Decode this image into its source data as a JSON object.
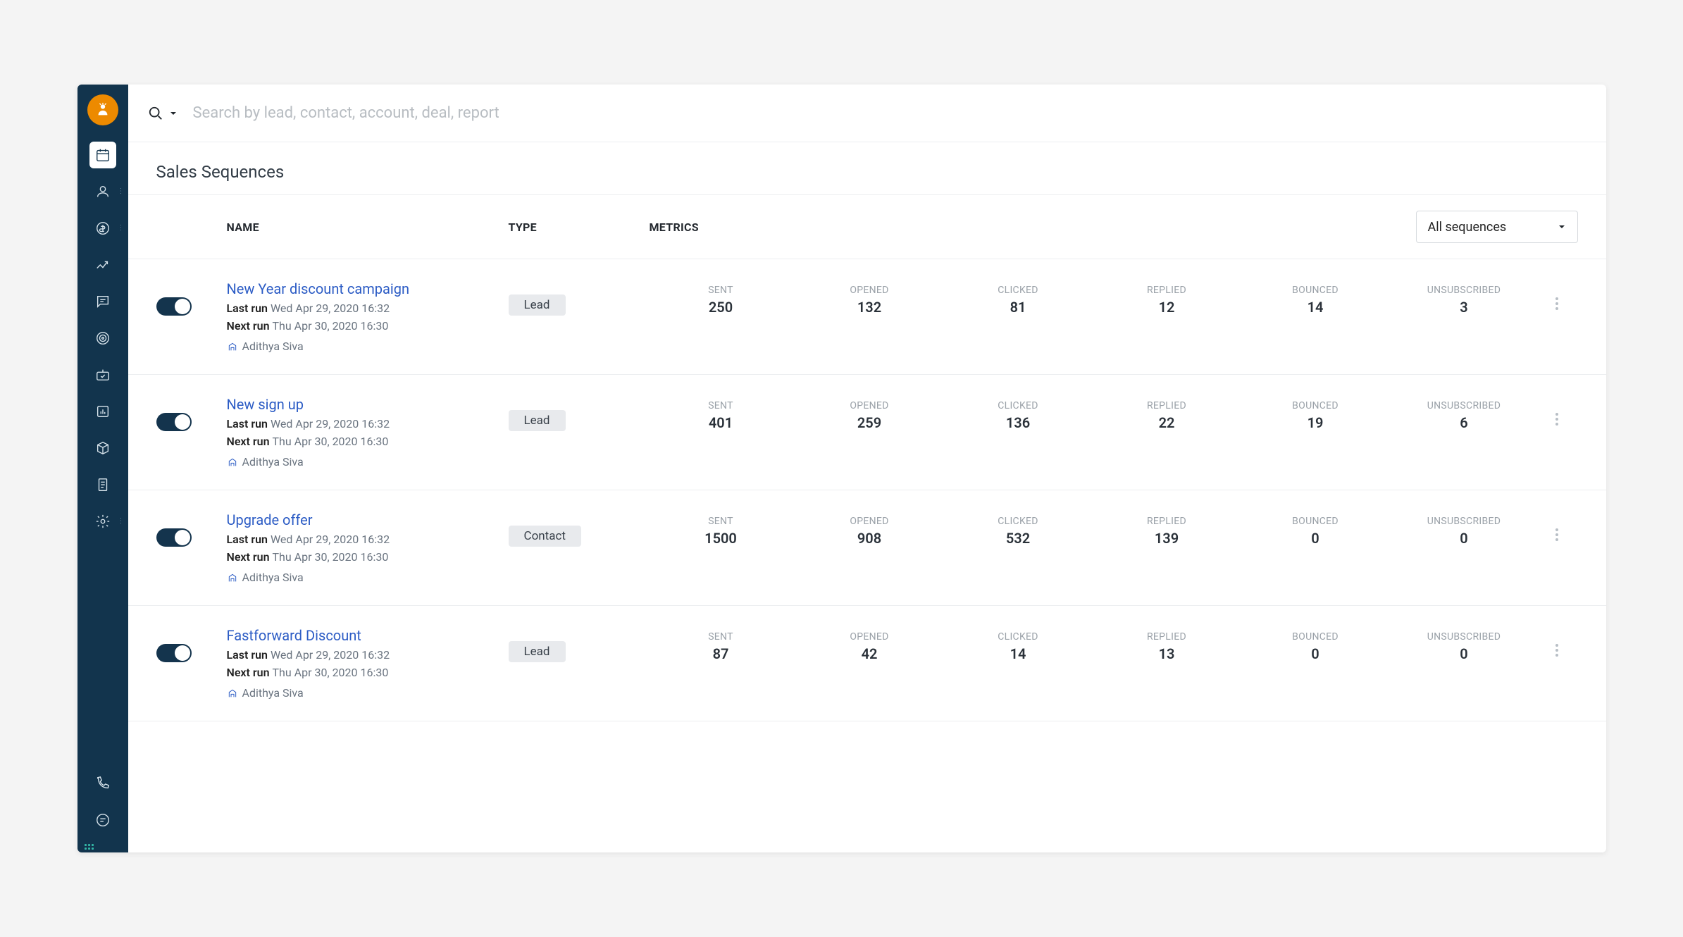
{
  "search": {
    "placeholder": "Search by lead, contact, account, deal, report"
  },
  "page": {
    "title": "Sales Sequences"
  },
  "table": {
    "headers": {
      "name": "NAME",
      "type": "TYPE",
      "metrics": "METRICS"
    },
    "filter_label": "All sequences",
    "metric_labels": [
      "SENT",
      "OPENED",
      "CLICKED",
      "REPLIED",
      "BOUNCED",
      "UNSUBSCRIBED"
    ],
    "run_labels": {
      "last": "Last run",
      "next": "Next run"
    }
  },
  "rows": [
    {
      "name": "New Year discount campaign",
      "last_run": "Wed Apr 29, 2020 16:32",
      "next_run": "Thu Apr 30, 2020 16:30",
      "owner": "Adithya Siva",
      "type": "Lead",
      "metrics": {
        "sent": "250",
        "opened": "132",
        "clicked": "81",
        "replied": "12",
        "bounced": "14",
        "unsubscribed": "3"
      }
    },
    {
      "name": "New sign up",
      "last_run": "Wed Apr 29, 2020 16:32",
      "next_run": "Thu Apr 30, 2020 16:30",
      "owner": "Adithya Siva",
      "type": "Lead",
      "metrics": {
        "sent": "401",
        "opened": "259",
        "clicked": "136",
        "replied": "22",
        "bounced": "19",
        "unsubscribed": "6"
      }
    },
    {
      "name": "Upgrade offer",
      "last_run": "Wed Apr 29, 2020 16:32",
      "next_run": "Thu Apr 30, 2020 16:30",
      "owner": "Adithya Siva",
      "type": "Contact",
      "metrics": {
        "sent": "1500",
        "opened": "908",
        "clicked": "532",
        "replied": "139",
        "bounced": "0",
        "unsubscribed": "0"
      }
    },
    {
      "name": "Fastforward Discount",
      "last_run": "Wed Apr 29, 2020 16:32",
      "next_run": "Thu Apr 30, 2020 16:30",
      "owner": "Adithya Siva",
      "type": "Lead",
      "metrics": {
        "sent": "87",
        "opened": "42",
        "clicked": "14",
        "replied": "13",
        "bounced": "0",
        "unsubscribed": "0"
      }
    }
  ]
}
